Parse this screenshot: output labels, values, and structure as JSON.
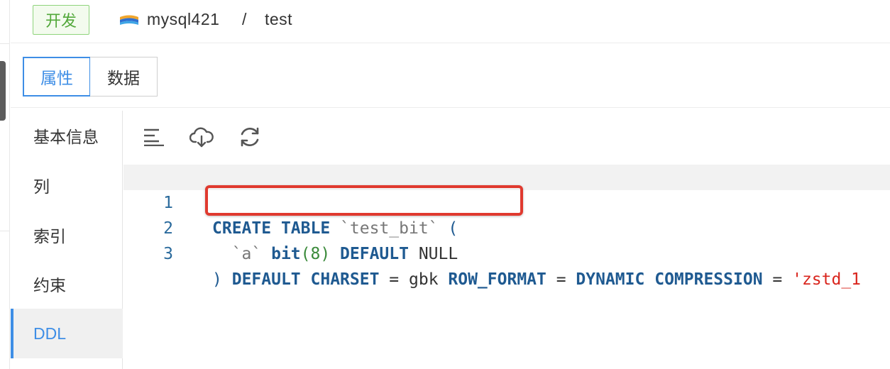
{
  "header": {
    "env_tag": "开发",
    "db_name": "mysql421",
    "separator": "/",
    "table_name": "test"
  },
  "tabs": [
    {
      "label": "属性",
      "active": true
    },
    {
      "label": "数据",
      "active": false
    }
  ],
  "side_nav": [
    {
      "label": "基本信息",
      "active": false
    },
    {
      "label": "列",
      "active": false
    },
    {
      "label": "索引",
      "active": false
    },
    {
      "label": "约束",
      "active": false
    },
    {
      "label": "DDL",
      "active": true
    }
  ],
  "toolbar": {
    "icons": [
      "format-icon",
      "download-cloud-icon",
      "refresh-icon"
    ]
  },
  "editor": {
    "lines": [
      {
        "number": "1",
        "tokens": [
          {
            "t": "CREATE",
            "c": "kw"
          },
          {
            "t": " ",
            "c": "plain"
          },
          {
            "t": "TABLE",
            "c": "kw"
          },
          {
            "t": " `test_bit` ",
            "c": "id"
          },
          {
            "t": "(",
            "c": "par"
          }
        ]
      },
      {
        "number": "2",
        "tokens": [
          {
            "t": "  `a` ",
            "c": "id"
          },
          {
            "t": "bit",
            "c": "kw"
          },
          {
            "t": "(8)",
            "c": "num"
          },
          {
            "t": " ",
            "c": "plain"
          },
          {
            "t": "DEFAULT",
            "c": "kw"
          },
          {
            "t": " NULL",
            "c": "plain"
          }
        ]
      },
      {
        "number": "3",
        "tokens": [
          {
            "t": ")",
            "c": "par"
          },
          {
            "t": " ",
            "c": "plain"
          },
          {
            "t": "DEFAULT",
            "c": "kw"
          },
          {
            "t": " ",
            "c": "plain"
          },
          {
            "t": "CHARSET",
            "c": "kw"
          },
          {
            "t": " = gbk ",
            "c": "plain"
          },
          {
            "t": "ROW_FORMAT",
            "c": "kw"
          },
          {
            "t": " = ",
            "c": "plain"
          },
          {
            "t": "DYNAMIC",
            "c": "kw"
          },
          {
            "t": " ",
            "c": "plain"
          },
          {
            "t": "COMPRESSION",
            "c": "kw"
          },
          {
            "t": " = ",
            "c": "plain"
          },
          {
            "t": "'zstd_1",
            "c": "str"
          }
        ]
      }
    ],
    "current_line": 1,
    "highlighted_line": 2
  },
  "colors": {
    "accent": "#3e8ee6",
    "env_tag_green": "#52a83a",
    "highlight_red": "#e03a2f",
    "keyword": "#1f5a91"
  }
}
